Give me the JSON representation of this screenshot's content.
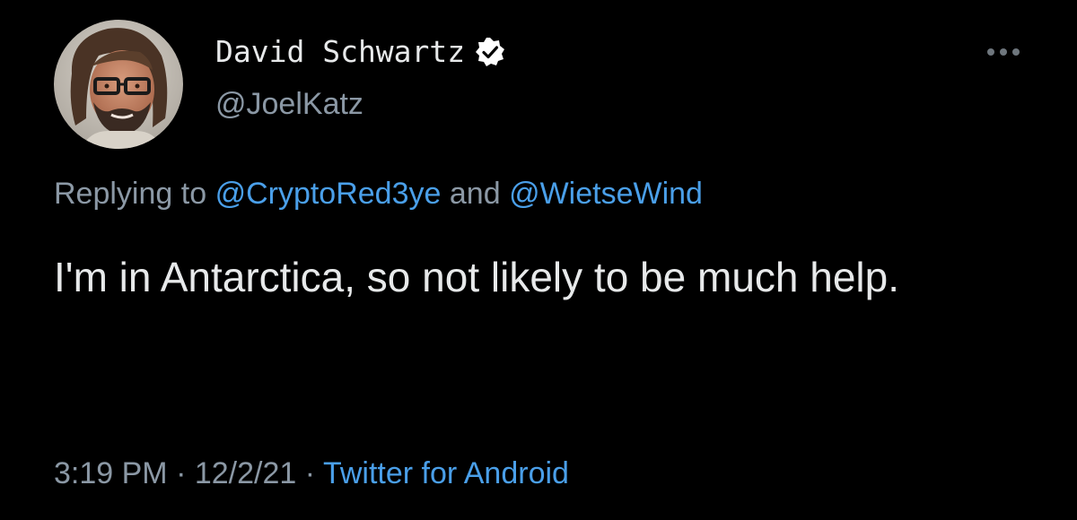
{
  "author": {
    "display_name": "David Schwartz",
    "handle": "@JoelKatz",
    "verified": true,
    "avatar_icon": "profile-photo-avatar"
  },
  "menu": {
    "icon": "more-horizontal-icon"
  },
  "reply": {
    "prefix": "Replying to",
    "mention_1": "@CryptoRed3ye",
    "connector": "and",
    "mention_2": "@WietseWind"
  },
  "tweet": {
    "text": "I'm in Antarctica, so not likely to be much help."
  },
  "meta": {
    "time": "3:19 PM",
    "separator": "·",
    "date": "12/2/21",
    "source": "Twitter for Android"
  },
  "colors": {
    "background": "#000000",
    "primary_text": "#e7e9ea",
    "secondary_text": "#8b98a5",
    "link": "#4a9fe9",
    "verified_badge_fill": "#ffffff"
  }
}
